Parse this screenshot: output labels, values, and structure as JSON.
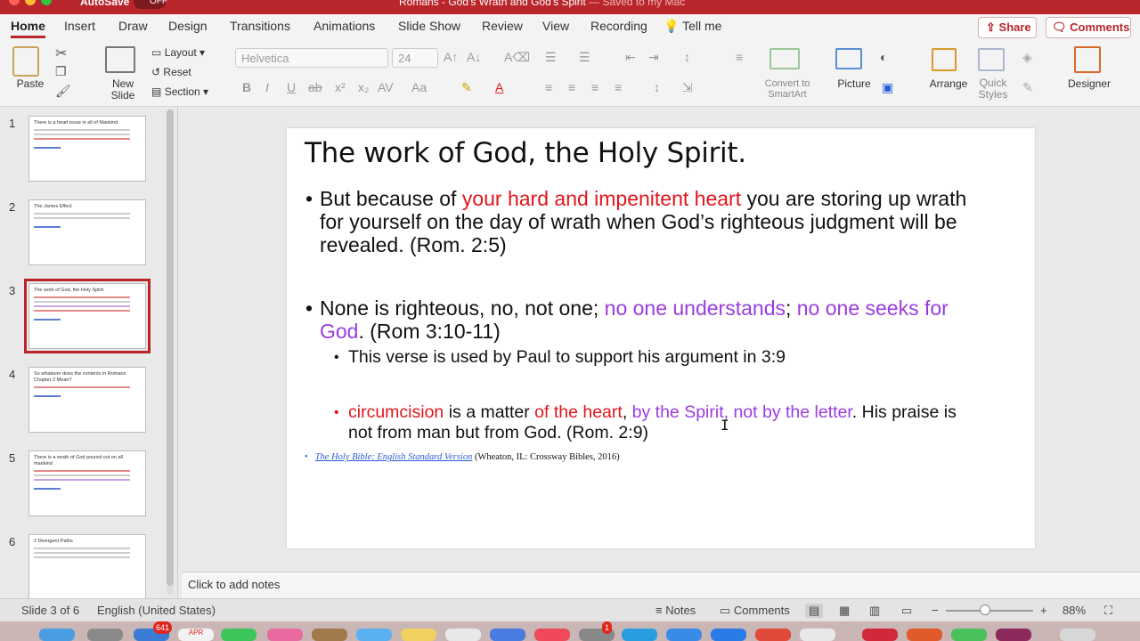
{
  "titlebar": {
    "autosave_label": "AutoSave",
    "autosave_state": "OFF",
    "document_title": "Romans - God's Wrath and God's Spirit",
    "saved_status": "— Saved to my Mac"
  },
  "tabs": [
    "Home",
    "Insert",
    "Draw",
    "Design",
    "Transitions",
    "Animations",
    "Slide Show",
    "Review",
    "View",
    "Recording"
  ],
  "tell_me": "Tell me",
  "share_label": "Share",
  "comments_label": "Comments",
  "ribbon": {
    "paste": "Paste",
    "new_slide": "New Slide",
    "layout": "Layout",
    "reset": "Reset",
    "section": "Section",
    "font_name": "Helvetica",
    "font_size": "24",
    "convert_smartart": "Convert to SmartArt",
    "picture": "Picture",
    "arrange": "Arrange",
    "quick_styles": "Quick Styles",
    "designer": "Designer"
  },
  "thumbnails": [
    {
      "num": "1",
      "title": "There is a heart issue in all of Mankind"
    },
    {
      "num": "2",
      "title": "The James Effect"
    },
    {
      "num": "3",
      "title": "The work of God, the Holy Spirit."
    },
    {
      "num": "4",
      "title": "So whatever does the contents in Romans Chapter 2 Mean?"
    },
    {
      "num": "5",
      "title": "There is a wrath of God poured out on all mankind"
    },
    {
      "num": "6",
      "title": "2 Divergent Paths"
    }
  ],
  "slide": {
    "title": "The work of God, the Holy Spirit.",
    "b1_pre": "But because of ",
    "b1_red": "your hard and impenitent heart",
    "b1_post1": " you are storing up wrath",
    "b1_line2": "for yourself on the day of wrath when God’s righteous judgment will be",
    "b1_line3": "revealed. (Rom. 2:5)",
    "b2_pre": "None is righteous, no, not one; ",
    "b2_p1": "no one understands",
    "b2_mid": "; ",
    "b2_p2": "no one seeks for",
    "b2_p3": "God",
    "b2_post": ". (Rom 3:10-11)",
    "s1": "This verse is used by Paul to support his argument in 3:9",
    "s2_red1": "circumcision",
    "s2_mid1": " is a matter ",
    "s2_red2": "of the heart",
    "s2_comma": ", ",
    "s2_purple": "by the Spirit, not by the letter",
    "s2_post": ". His praise is",
    "s2_line2": "not from man but from God. (Rom. 2:9)",
    "cite_link": "The Holy Bible: English Standard Version",
    "cite_rest": " (Wheaton, IL: Crossway Bibles, 2016)"
  },
  "notes_placeholder": "Click to add notes",
  "status": {
    "slide_info": "Slide 3 of 6",
    "language": "English (United States)",
    "notes": "Notes",
    "comments": "Comments",
    "zoom": "88%"
  },
  "dock": {
    "mail_badge": "641",
    "calendar_month": "APR",
    "other_badge": "1"
  }
}
